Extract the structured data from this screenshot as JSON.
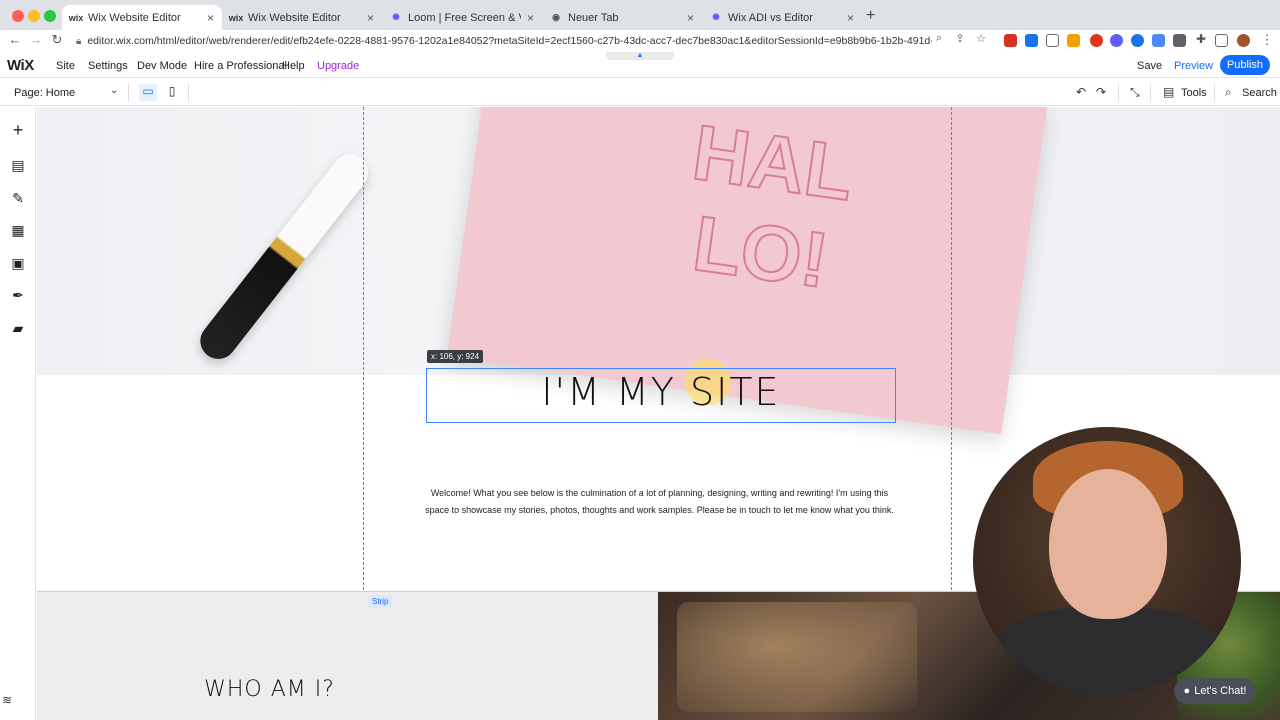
{
  "browser": {
    "tabs": [
      {
        "label": "Wix Website Editor",
        "active": true
      },
      {
        "label": "Wix Website Editor",
        "active": false
      },
      {
        "label": "Loom | Free Screen & Video Re",
        "active": false
      },
      {
        "label": "Neuer Tab",
        "active": false
      },
      {
        "label": "Wix ADI vs Editor",
        "active": false
      }
    ],
    "url": "editor.wix.com/html/editor/web/renderer/edit/efb24efe-0228-4881-9576-1202a1e84052?metaSiteId=2ecf1560-c27b-43dc-acc7-dec7be830ac1&editorSessionId=e9b8b9b6-1b2b-491d-..."
  },
  "wix_topbar": {
    "logo": "WiX",
    "menu": [
      "Site",
      "Settings",
      "Dev Mode",
      "Hire a Professional",
      "Help",
      "Upgrade"
    ],
    "save": "Save",
    "preview": "Preview",
    "publish": "Publish"
  },
  "page_bar": {
    "page_selector": "Page: Home",
    "tools": "Tools",
    "search": "Search"
  },
  "canvas": {
    "coord_tooltip": "x: 106, y: 924",
    "site_title": "I'M MY SITE",
    "intro": "Welcome! What you see below is the culmination of a lot of planning, designing, writing and rewriting! I'm using this space to showcase my stories, photos, thoughts and work samples. Please be in touch to let me know what you think.",
    "strip_tag": "Strip",
    "who_heading": "WHO AM I?",
    "hero_image_text": "HAL LO!"
  },
  "chat": {
    "label": "Let's Chat!"
  },
  "colors": {
    "accent": "#116dff",
    "upgrade": "#9a27d5"
  }
}
